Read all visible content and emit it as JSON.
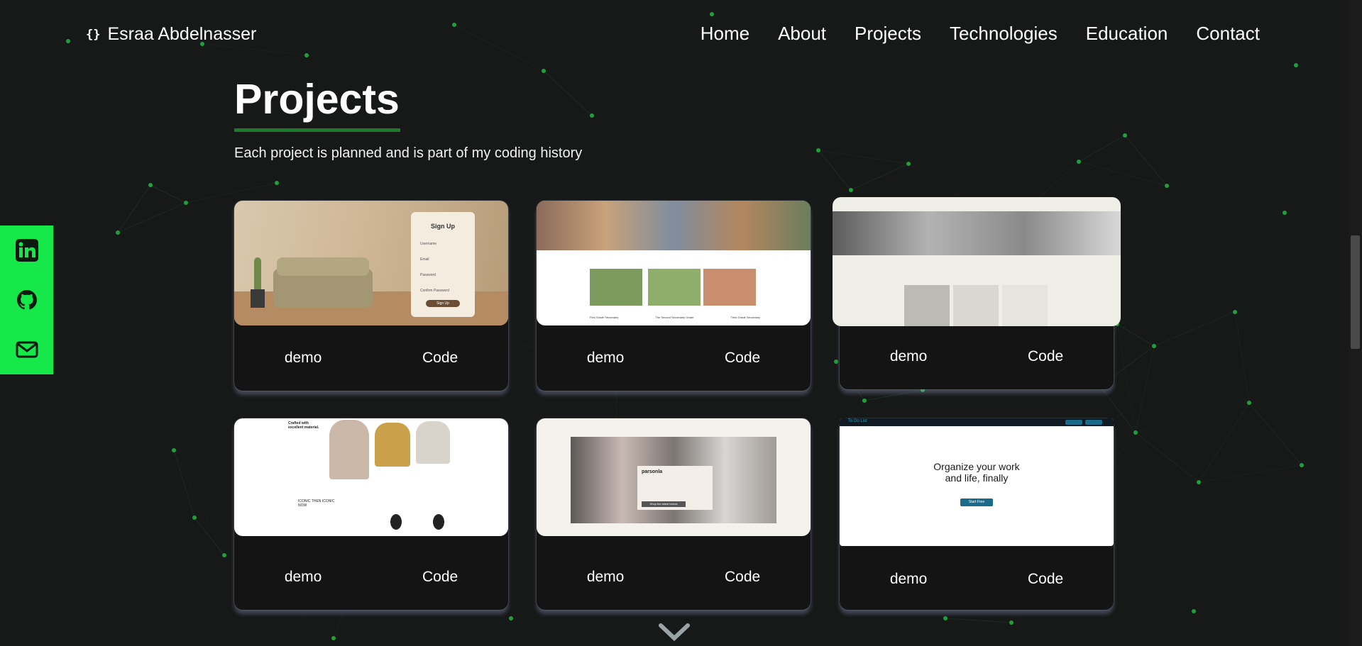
{
  "header": {
    "logo_icon": "curly-braces",
    "logo_text": "Esraa Abdelnasser",
    "nav": [
      "Home",
      "About",
      "Projects",
      "Technologies",
      "Education",
      "Contact"
    ]
  },
  "projects": {
    "title": "Projects",
    "subtitle": "Each project is planned and is part of my coding history",
    "cards": [
      {
        "demo": "demo",
        "code": "Code",
        "thumb": {
          "heading": "Sign Up",
          "field_labels": [
            "Username",
            "Email",
            "Password",
            "Confirm Password"
          ],
          "button": "Sign Up"
        }
      },
      {
        "demo": "demo",
        "code": "Code",
        "thumb": {
          "items": [
            "First Grade Secondary",
            "The Second Secondary Grade",
            "Third Grade Secondary"
          ]
        }
      },
      {
        "demo": "demo",
        "code": "Code",
        "thumb": {}
      },
      {
        "demo": "demo",
        "code": "Code",
        "thumb": {
          "heading": "Crafted with excellent material.",
          "subheading": "ICONIC THEN ICONIC NOW"
        }
      },
      {
        "demo": "demo",
        "code": "Code",
        "thumb": {
          "heading": "parsonla",
          "button": "Shop the latest trends"
        }
      },
      {
        "demo": "demo",
        "code": "Code",
        "thumb": {
          "brand": "To Do List",
          "heading_line1": "Organize your work",
          "heading_line2": "and life, finally",
          "button": "Start Free"
        }
      }
    ]
  },
  "social": [
    "linkedin-icon",
    "github-icon",
    "mail-icon"
  ],
  "scroll_icon": "chevron-down-icon",
  "colors": {
    "background": "#171818",
    "accent": "#16e84a",
    "underline": "#1e7a2c",
    "card": "#141414"
  }
}
